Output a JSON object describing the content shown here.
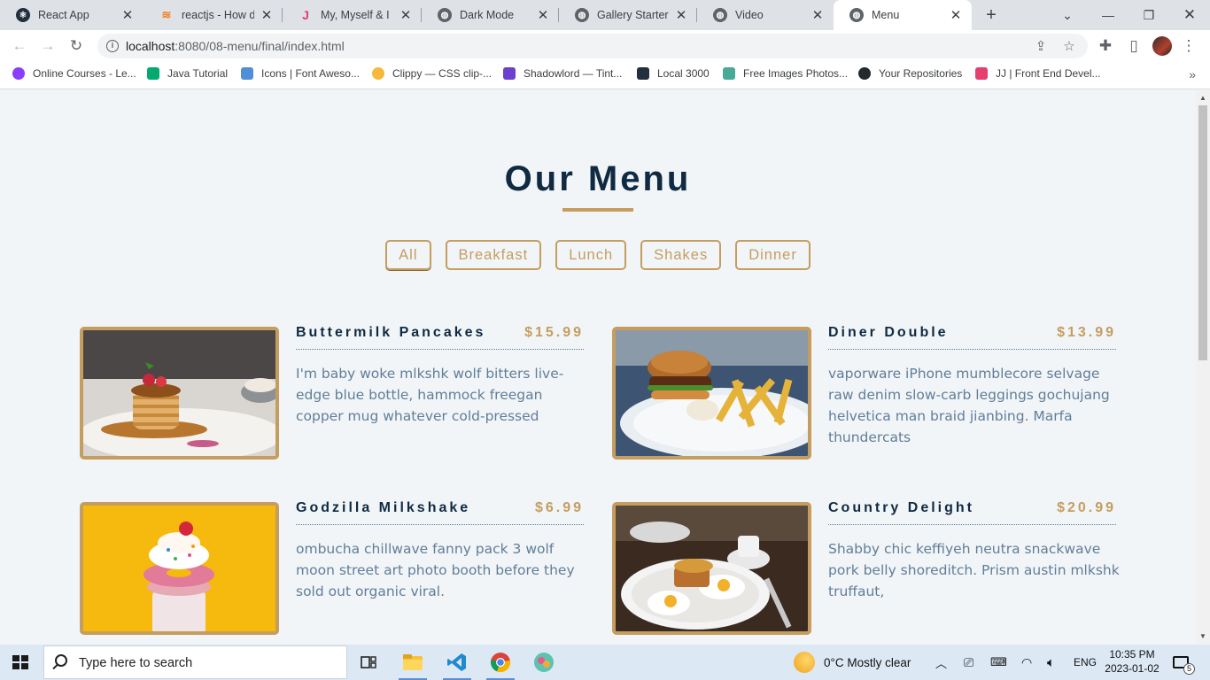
{
  "browser": {
    "tabs": [
      {
        "title": "React App",
        "icon": "react-icon",
        "color": "#222f3e"
      },
      {
        "title": "reactjs - How do",
        "icon": "stackoverflow-icon",
        "color": "#f48024"
      },
      {
        "title": "My, Myself & I | J",
        "icon": "jj-icon",
        "color": "#e53e6f"
      },
      {
        "title": "Dark Mode",
        "icon": "globe-icon",
        "color": "#5f6368"
      },
      {
        "title": "Gallery Starter",
        "icon": "globe-icon",
        "color": "#5f6368"
      },
      {
        "title": "Video",
        "icon": "globe-icon",
        "color": "#5f6368"
      },
      {
        "title": "Menu",
        "icon": "globe-icon",
        "color": "#5f6368",
        "active": true
      }
    ],
    "address": {
      "host": "localhost",
      "path": ":8080/08-menu/final/index.html"
    },
    "bookmarks": [
      {
        "label": "Online Courses - Le...",
        "color": "#8a3ffc"
      },
      {
        "label": "Java Tutorial",
        "color": "#04aa6d"
      },
      {
        "label": "Icons | Font Aweso...",
        "color": "#528dd7"
      },
      {
        "label": "Clippy — CSS clip-...",
        "color": "#f6b93b"
      },
      {
        "label": "Shadowlord — Tint...",
        "color": "#6c3fd1"
      },
      {
        "label": "Local 3000",
        "color": "#222f3e"
      },
      {
        "label": "Free Images Photos...",
        "color": "#48a999"
      },
      {
        "label": "Your Repositories",
        "color": "#24292e"
      },
      {
        "label": "JJ | Front End Devel...",
        "color": "#e53e6f"
      }
    ]
  },
  "page": {
    "title": "Our Menu",
    "filters": [
      "All",
      "Breakfast",
      "Lunch",
      "Shakes",
      "Dinner"
    ],
    "accent": "#c59d5f",
    "items": [
      {
        "name": "Buttermilk Pancakes",
        "price": "$15.99",
        "desc": "I'm baby woke mlkshk wolf bitters live-edge blue bottle, hammock freegan copper mug whatever cold-pressed",
        "image": "pancakes-photo"
      },
      {
        "name": "Diner Double",
        "price": "$13.99",
        "desc": "vaporware iPhone mumblecore selvage raw denim slow-carb leggings gochujang helvetica man braid jianbing. Marfa thundercats",
        "image": "burger-photo"
      },
      {
        "name": "Godzilla Milkshake",
        "price": "$6.99",
        "desc": "ombucha chillwave fanny pack 3 wolf moon street art photo booth before they sold out organic viral.",
        "image": "milkshake-photo"
      },
      {
        "name": "Country Delight",
        "price": "$20.99",
        "desc": "Shabby chic keffiyeh neutra snackwave pork belly shoreditch. Prism austin mlkshk truffaut,",
        "image": "breakfast-photo"
      }
    ]
  },
  "taskbar": {
    "search_placeholder": "Type here to search",
    "weather": "0°C  Mostly clear",
    "lang": "ENG",
    "time": "10:35 PM",
    "date": "2023-01-02",
    "notifications": "5"
  }
}
